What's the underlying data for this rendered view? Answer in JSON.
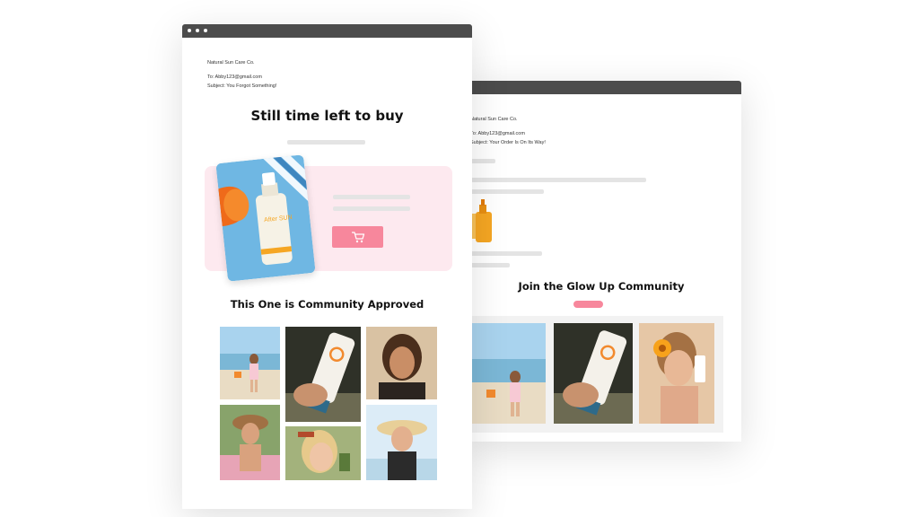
{
  "back_email": {
    "from": "Natural Sun Care Co.",
    "to": "To: Abby123@gmail.com",
    "subject": "Subject: Your Order Is On Its Way!",
    "heading": "Join the Glow Up Community"
  },
  "front_email": {
    "from": "Natural Sun Care Co.",
    "to": "To: Abby123@gmail.com",
    "subject": "Subject: You Forgot Something!",
    "heading": "Still time left to buy",
    "product_label": "After SUN",
    "community_heading": "This One is Community Approved"
  },
  "colors": {
    "accent_pink": "#f7879c",
    "band_pink": "#fde9ef",
    "window_bar": "#4c4c4c"
  },
  "icons": [
    "cart-icon"
  ]
}
